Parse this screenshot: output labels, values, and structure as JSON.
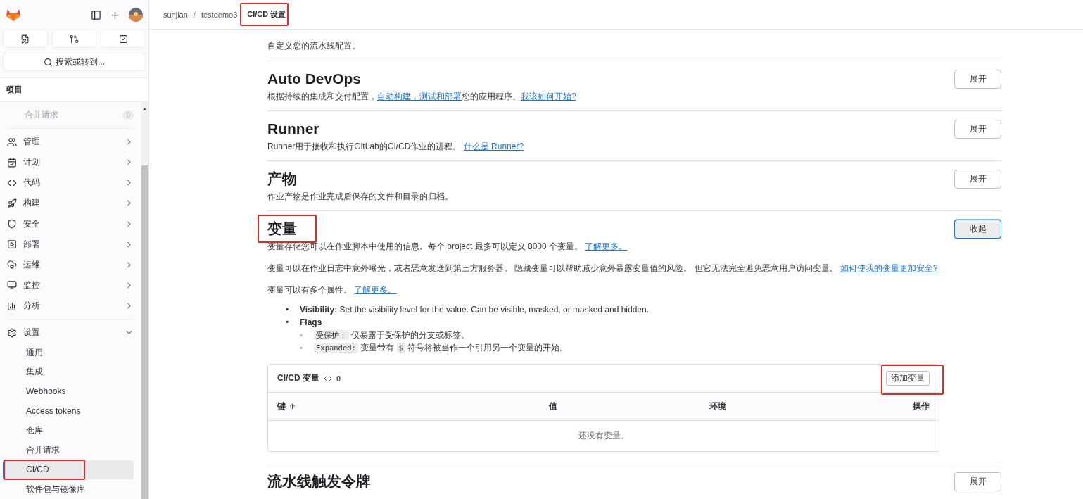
{
  "sidebar": {
    "search": {
      "placeholder": "搜索或转到..."
    },
    "section_label": "项目",
    "nav": [
      {
        "label": "合并请求",
        "kind": "faded",
        "count": "0"
      },
      {
        "label": "管理",
        "kind": "group",
        "expanded": false
      },
      {
        "label": "计划",
        "kind": "group",
        "expanded": false
      },
      {
        "label": "代码",
        "kind": "group",
        "expanded": false
      },
      {
        "label": "构建",
        "kind": "group",
        "expanded": false
      },
      {
        "label": "安全",
        "kind": "group",
        "expanded": false
      },
      {
        "label": "部署",
        "kind": "group",
        "expanded": false
      },
      {
        "label": "运维",
        "kind": "group",
        "expanded": false
      },
      {
        "label": "监控",
        "kind": "group",
        "expanded": false
      },
      {
        "label": "分析",
        "kind": "group",
        "expanded": false
      },
      {
        "label": "设置",
        "kind": "group",
        "expanded": true,
        "children": [
          {
            "label": "通用",
            "selected": false
          },
          {
            "label": "集成",
            "selected": false
          },
          {
            "label": "Webhooks",
            "selected": false
          },
          {
            "label": "Access tokens",
            "selected": false
          },
          {
            "label": "仓库",
            "selected": false
          },
          {
            "label": "合并请求",
            "selected": false
          },
          {
            "label": "CI/CD",
            "selected": true,
            "highlighted": true
          },
          {
            "label": "软件包与镜像库",
            "selected": false
          }
        ]
      }
    ]
  },
  "breadcrumb_separator": "/",
  "breadcrumbs": [
    {
      "label": "sunjian",
      "current": false
    },
    {
      "label": "testdemo3",
      "current": false
    },
    {
      "label": "CI/CD 设置",
      "current": true,
      "highlighted": true
    }
  ],
  "sections": [
    {
      "description": [
        {
          "text": "自定义您的流水线配置。"
        }
      ]
    },
    {
      "title": "Auto DevOps",
      "button": "展开",
      "expanded": false,
      "description": [
        {
          "text": "根据持续的集成和交付配置，"
        },
        {
          "text": "自动构建，测试和部署",
          "link": true
        },
        {
          "text": "您的应用程序。"
        },
        {
          "text": "我该如何开始?",
          "link": true
        }
      ]
    },
    {
      "title": "Runner",
      "button": "展开",
      "expanded": false,
      "description": [
        {
          "text": "Runner用于接收和执行GitLab的CI/CD作业的进程。 "
        },
        {
          "text": "什么是 Runner?",
          "link": true
        }
      ]
    },
    {
      "title": "产物",
      "button": "展开",
      "expanded": false,
      "description": [
        {
          "text": "作业产物是作业完成后保存的文件和目录的归档。"
        }
      ]
    },
    {
      "title": "变量",
      "highlighted": true,
      "button": "收起",
      "expanded": true,
      "description": [
        {
          "text": "变量存储您可以在作业脚本中使用的信息。每个 project 最多可以定义 8000 个变量。 "
        },
        {
          "text": "了解更多。",
          "link": true
        }
      ],
      "paragraphs": [
        [
          {
            "text": "变量可以在作业日志中意外曝光，或者恶意发送到第三方服务器。 隐藏变量可以帮助减少意外暴露变量值的风险。 但它无法完全避免恶意用户访问变量。 "
          },
          {
            "text": "如何使我的变量更加安全?",
            "link": true
          }
        ],
        [
          {
            "text": "变量可以有多个属性。 "
          },
          {
            "text": "了解更多。",
            "link": true
          }
        ]
      ],
      "bullets": [
        {
          "marker": "•",
          "label": "Visibility:",
          "text": "Set the visibility level for the value. Can be visible, masked, or masked and hidden."
        },
        {
          "marker": "•",
          "label": "Flags",
          "items": [
            {
              "marker": "◦",
              "parts": [
                {
                  "text": "受保护：",
                  "code": true
                },
                {
                  "text": " 仅暴露于受保护的分支或标签。"
                }
              ]
            },
            {
              "marker": "◦",
              "parts": [
                {
                  "text": "Expanded:",
                  "code": true
                },
                {
                  "text": " 变量带有 "
                },
                {
                  "text": "$",
                  "code": true
                },
                {
                  "text": " 符号将被当作一个引用另一个变量的开始。"
                }
              ]
            }
          ]
        }
      ],
      "table": {
        "title": "CI/CD 变量",
        "count": "0",
        "add_button": "添加变量",
        "add_highlighted": true,
        "columns": [
          {
            "label": "键",
            "sorted": true
          },
          {
            "label": "值",
            "sorted": false
          },
          {
            "label": "环境",
            "sorted": false
          },
          {
            "label": "操作",
            "sorted": false
          }
        ],
        "empty": "还没有变量。"
      }
    },
    {
      "title": "流水线触发令牌",
      "button": "展开",
      "expanded": false
    }
  ]
}
